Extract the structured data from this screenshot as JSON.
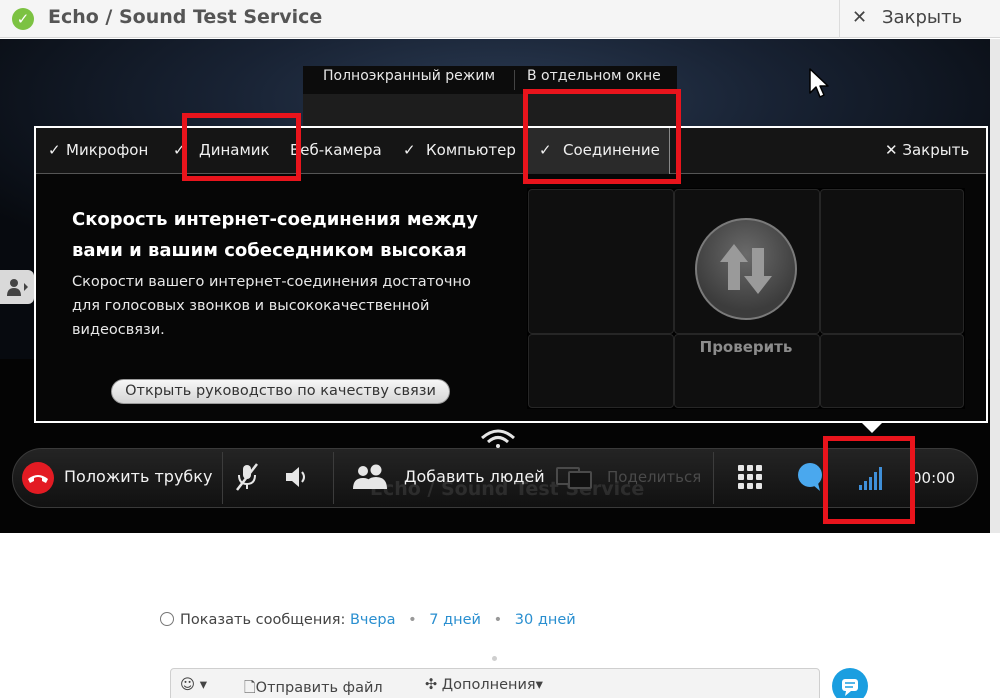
{
  "window": {
    "title": "Echo / Sound Test Service",
    "close_label": "Закрыть"
  },
  "view": {
    "fullscreen_label": "Полноэкранный режим",
    "separate_window_label": "В отдельном окне"
  },
  "quality_panel": {
    "tabs": [
      {
        "label": "Микрофон",
        "checked": true
      },
      {
        "label": "Динамик",
        "checked": true
      },
      {
        "label": "Веб-камера",
        "checked": false
      },
      {
        "label": "Компьютер",
        "checked": true
      },
      {
        "label": "Соединение",
        "checked": true,
        "selected": true
      }
    ],
    "close_label": "Закрыть",
    "heading_line1": "Скорость интернет-соединения между",
    "heading_line2": "вами и вашим собеседником высокая",
    "body_line1": "Скорости вашего интернет-соединения достаточно",
    "body_line2": "для голосовых звонков и высококачественной",
    "body_line3": "видеосвязи.",
    "guide_button": "Открыть руководство по качеству связи",
    "test_label": "Проверить"
  },
  "call_controls": {
    "hangup_label": "Положить трубку",
    "add_people_label": "Добавить людей",
    "share_label": "Поделиться",
    "overlay_title": "Echo / Sound Test Service",
    "timer": "00:00"
  },
  "history": {
    "label": "Показать сообщения:",
    "options": [
      "Вчера",
      "7 дней",
      "30 дней"
    ]
  },
  "compose": {
    "send_file_label": "Отправить файл",
    "addons_label": "Дополнения"
  },
  "colors": {
    "highlight": "#e8141c",
    "hangup": "#e31b23",
    "link": "#2a8fd0",
    "accent_blue": "#1a9ee0"
  }
}
